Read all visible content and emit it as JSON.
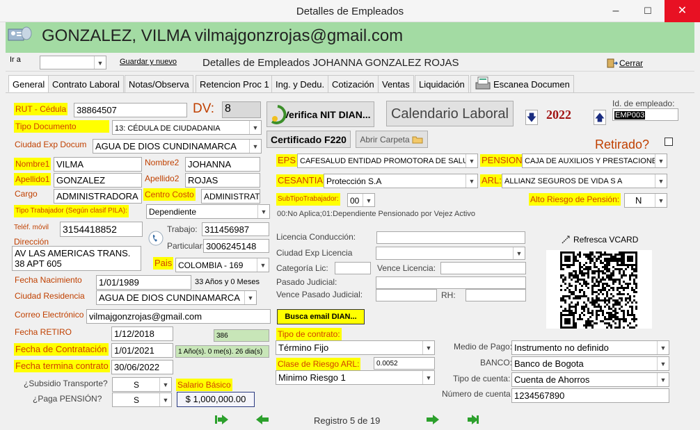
{
  "window": {
    "title": "Detalles de Empleados",
    "min": "–",
    "max": "☐",
    "close": "✕"
  },
  "header": {
    "title": "GONZALEZ, VILMA vilmajgonzrojas@gmail.com"
  },
  "toolbar": {
    "ir_a": "Ir a",
    "guardar": "Guardar y nuevo",
    "subtitle": "Detalles de Empleados JOHANNA GONZALEZ ROJAS",
    "cerrar": "Cerrar"
  },
  "tabs": [
    "General",
    "Contrato Laboral",
    "Notas/Observa",
    "Retencion Proc 1",
    "Ing. y Dedu.",
    "Cotización",
    "Ventas",
    "Liquidación",
    "Escanea Documen"
  ],
  "form": {
    "rut_label": "RUT - Cédula",
    "rut": "38864507",
    "dv_label": "DV:",
    "dv": "8",
    "verifica_nit": "Verifica NIT DIAN...",
    "calendario": "Calendario Laboral",
    "year": "2022",
    "id_emp_label": "Id. de empleado:",
    "id_emp": "EMP003",
    "tipo_doc_label": "Tipo Documento",
    "tipo_doc": "13: CÉDULA DE CIUDADANIA",
    "cert_f220": "Certificado F220",
    "abrir_carpeta": "Abrir Carpeta",
    "retirado_label": "Retirado?",
    "ciudad_exp_label": "Ciudad Exp Docum",
    "ciudad_exp": "AGUA DE DIOS  CUNDINAMARCA",
    "nombre1_label": "Nombre1",
    "nombre1": "VILMA",
    "nombre2_label": "Nombre2",
    "nombre2": "JOHANNA",
    "apellido1_label": "Apellido1",
    "apellido1": "GONZALEZ",
    "apellido2_label": "Apellido2",
    "apellido2": "ROJAS",
    "cargo_label": "Cargo",
    "cargo": "ADMINISTRADORA",
    "centro_costo_label": "Centro Costo",
    "centro_costo": "ADMINISTRAT",
    "tipo_trab_label": "Tipo Trabajador (Según clasif PILA):",
    "tipo_trab": "Dependiente",
    "telef_label": "Teléf. móvil",
    "telef": "3154418852",
    "trabajo_label": "Trabajo:",
    "trabajo": "311456987",
    "particular_label": "Particular:",
    "particular": "3006245148",
    "direccion_label": "Dirección",
    "direccion1": "AV LAS AMERICAS TRANS.",
    "direccion2": "38 APT 605",
    "pais_label": "Pais",
    "pais": "COLOMBIA - 169",
    "fecha_nac_label": "Fecha Nacimiento",
    "fecha_nac": "1/01/1989",
    "edad": "33 Años y 0 Meses",
    "ciudad_res_label": "Ciudad Residencia",
    "ciudad_res": "AGUA DE DIOS  CUNDINAMARCA",
    "correo_label": "Correo Electrónico",
    "correo": "vilmajgonzrojas@gmail.com",
    "fecha_retiro_label": "Fecha RETIRO",
    "fecha_retiro": "1/12/2018",
    "dias": "386",
    "fecha_contr_label": "Fecha de Contratación",
    "fecha_contr": "1/01/2021",
    "antig": "1 Año(s). 0 me(s). 26 dia(s)",
    "fecha_term_label": "Fecha termina contrato",
    "fecha_term": "30/06/2022",
    "subsidio_label": "¿Subsidio Transporte?",
    "subsidio": "S",
    "paga_pension_label": "¿Paga PENSIÓN?",
    "paga_pension": "S",
    "salario_label": "Salario Básico",
    "salario": "$ 1,000,000.00",
    "eps_label": "EPS",
    "eps": "CAFESALUD ENTIDAD PROMOTORA DE SALUD",
    "pension_label": "PENSION",
    "pension": "CAJA DE AUXILIOS Y PRESTACIONES",
    "cesantias_label": "CESANTIAS",
    "cesantias": "Protección S.A",
    "arl_label": "ARL:",
    "arl": "ALLIANZ SEGUROS DE VIDA S A",
    "subtipo_label": "SubTipoTrabajador:",
    "subtipo": "00",
    "subtipo_desc": "00:No Aplica;01:Dependiente Pensionado por Vejez Activo",
    "alto_riesgo_label": "Alto Riesgo de Pensión:",
    "alto_riesgo": "N",
    "lic_cond_label": "Licencia Conducción:",
    "ciudad_lic_label": "Ciudad Exp Licencia",
    "cat_lic_label": "Categoría Lic:",
    "vence_lic_label": "Vence Licencia:",
    "pasado_jud_label": "Pasado Judicial:",
    "vence_pasado_label": "Vence Pasado Judicial:",
    "rh_label": "RH:",
    "refresca_vcard": "Refresca VCARD",
    "buscar_email": "Busca email DIAN...",
    "tipo_contrato_label": "Tipo de contrato:",
    "tipo_contrato": "Término Fijo",
    "clase_riesgo_label": "Clase de Riesgo ARL:",
    "clase_riesgo_val": "0.0052",
    "riesgo": "Minimo Riesgo 1",
    "medio_pago_label": "Medio de Pago:",
    "medio_pago": "Instrumento no definido",
    "banco_label": "BANCO:",
    "banco": "Banco de Bogota",
    "tipo_cuenta_label": "Tipo de cuenta:",
    "tipo_cuenta": "Cuenta de Ahorros",
    "num_cuenta_label": "Número de cuenta",
    "num_cuenta": "1234567890"
  },
  "nav": {
    "registro": "Registro 5 de 19"
  },
  "colors": {
    "header_green": "#a3dba3",
    "highlight_yellow": "#ffff00",
    "label_orange": "#c04000",
    "close_red": "#e81123",
    "year_red": "#a01010"
  }
}
